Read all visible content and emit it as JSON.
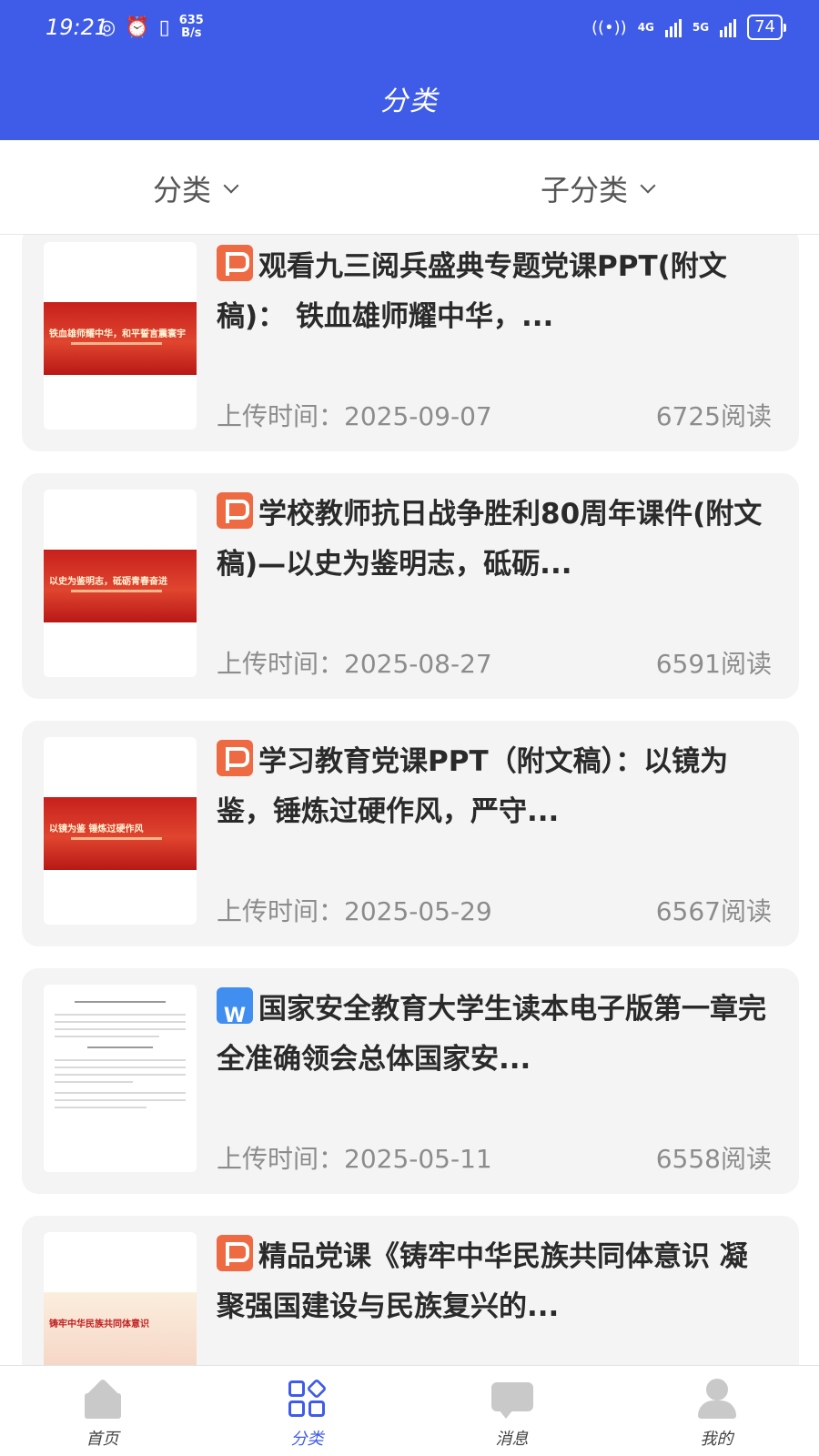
{
  "status_bar": {
    "time": "19:21",
    "net_speed_value": "635",
    "net_speed_unit": "B/s",
    "signal1": "4G",
    "signal2": "5G",
    "battery": "74"
  },
  "header": {
    "title": "分类"
  },
  "filters": {
    "category": "分类",
    "subcategory": "子分类"
  },
  "list": {
    "items": [
      {
        "type": "ppt",
        "title": "观看九三阅兵盛典专题党课PPT(附文稿)： 铁血雄师耀中华，...",
        "upload_label": "上传时间：2025-09-07",
        "reads": "6725阅读",
        "thumb_text": "铁血雄师耀中华，和平誓言震寰宇"
      },
      {
        "type": "ppt",
        "title": "学校教师抗日战争胜利80周年课件(附文稿)—以史为鉴明志，砥砺...",
        "upload_label": "上传时间：2025-08-27",
        "reads": "6591阅读",
        "thumb_text": "以史为鉴明志，砥砺青春奋进"
      },
      {
        "type": "ppt",
        "title": "学习教育党课PPT（附文稿）：以镜为鉴，锤炼过硬作风，严守...",
        "upload_label": "上传时间：2025-05-29",
        "reads": "6567阅读",
        "thumb_text": "以镜为鉴 锤炼过硬作风"
      },
      {
        "type": "doc",
        "title": "国家安全教育大学生读本电子版第一章完全准确领会总体国家安...",
        "upload_label": "上传时间：2025-05-11",
        "reads": "6558阅读",
        "thumb_text": ""
      },
      {
        "type": "ppt",
        "title": "精品党课《铸牢中华民族共同体意识 凝聚强国建设与民族复兴的...",
        "upload_label": "",
        "reads": "",
        "thumb_text": "铸牢中华民族共同体意识"
      }
    ]
  },
  "bottom_nav": [
    {
      "label": "首页",
      "icon": "home-icon"
    },
    {
      "label": "分类",
      "icon": "grid-icon"
    },
    {
      "label": "消息",
      "icon": "message-icon"
    },
    {
      "label": "我的",
      "icon": "user-icon"
    }
  ],
  "colors": {
    "primary": "#3f5ce8",
    "ppt": "#ee6a43",
    "doc": "#3f8ef0",
    "card_bg": "#f4f4f5"
  }
}
